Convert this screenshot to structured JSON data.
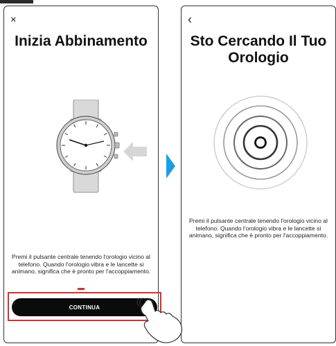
{
  "left_screen": {
    "close_icon": "×",
    "title": "Inizia Abbinamento",
    "description": "Premi il pulsante centrale tenendo l'orologio vicino al telefono. Quando l'orologio vibra e le lancette si animano, significa che è pronto per l'accoppiamento.",
    "continue_label": "CONTINUA"
  },
  "right_screen": {
    "back_icon": "‹",
    "title": "Sto Cercando Il Tuo Orologio",
    "description": "Premi il pulsante centrale tenendo l'orologio vicino al telefono. Quando l'orologio vibra e le lancette si animano, significa che è pronto per l'accoppiamento."
  },
  "icons": {
    "close": "close-icon",
    "back": "back-icon",
    "watch": "watch-illustration",
    "left_arrow": "arrow-left-icon",
    "next_arrow": "next-arrow-icon",
    "searching": "searching-rings-icon",
    "hand": "tapping-hand-icon"
  },
  "colors": {
    "accent_blue": "#1a9fe4",
    "highlight_red": "#d43030",
    "button_black": "#0b0b0b"
  }
}
